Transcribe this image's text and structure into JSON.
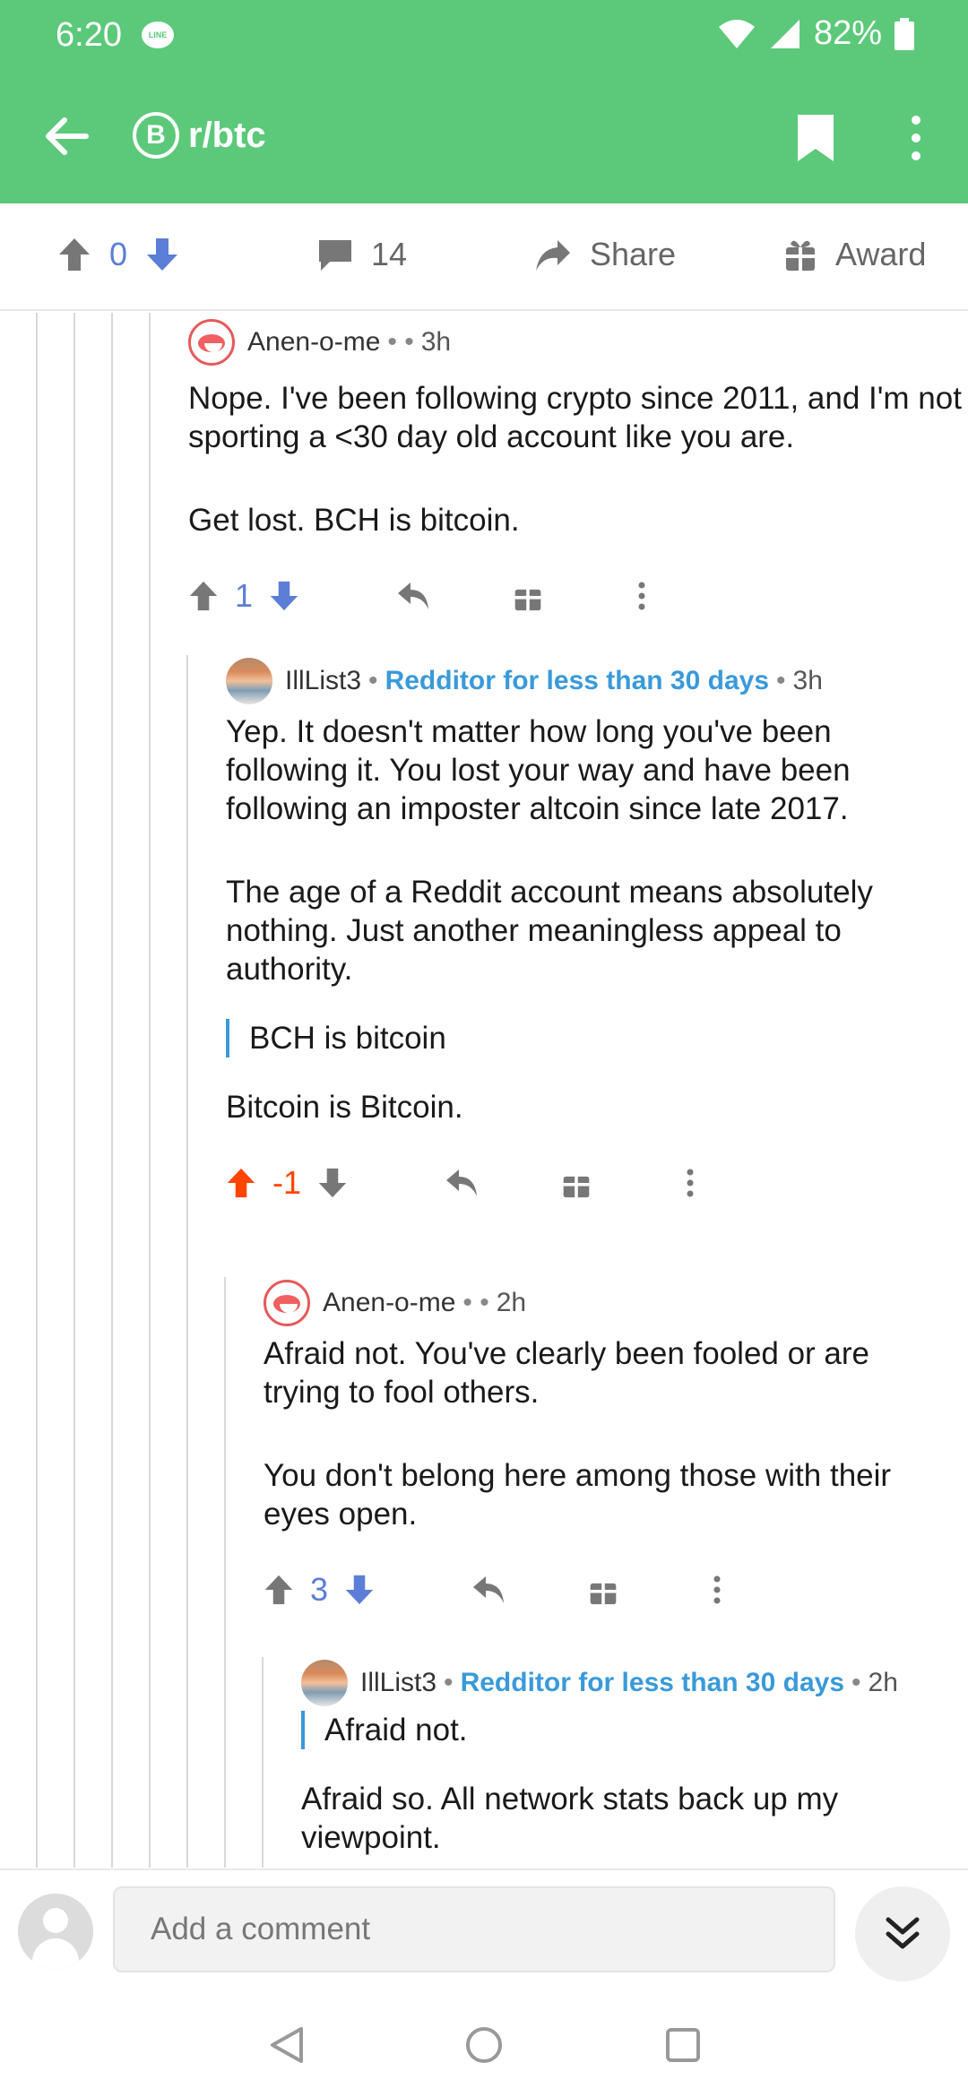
{
  "status_bar": {
    "time": "6:20",
    "line_badge": "LINE",
    "battery": "82%"
  },
  "app_bar": {
    "subreddit_symbol": "B",
    "subreddit": "r/btc"
  },
  "post_bar": {
    "score": "0",
    "comments": "14",
    "share_label": "Share",
    "award_label": "Award"
  },
  "comments": [
    {
      "author": "Anen-o-me",
      "flair": "",
      "age": "3h",
      "paragraphs": [
        "Nope. I've been following crypto since 2011, and I'm not sporting a <30 day old account like you are.",
        "Get lost. BCH is bitcoin."
      ],
      "score": "1"
    },
    {
      "author": "IllList3",
      "flair": "Redditor for less than 30 days",
      "age": "3h",
      "paragraphs": [
        "Yep.  It doesn't matter how long you've been following it.  You lost your way and have been following an imposter altcoin since late 2017.",
        "The age of a Reddit account means absolutely nothing.  Just another meaningless appeal to authority."
      ],
      "quote": "BCH is bitcoin",
      "after_quote": "Bitcoin is Bitcoin.",
      "score": "-1"
    },
    {
      "author": "Anen-o-me",
      "flair": "",
      "age": "2h",
      "paragraphs": [
        "Afraid not. You've clearly been fooled or are trying to fool others.",
        "You don't belong here among those with their eyes open."
      ],
      "score": "3"
    },
    {
      "author": "IllList3",
      "flair": "Redditor for less than 30 days",
      "age": "2h",
      "quote": "Afraid not.",
      "after_quote": "Afraid so.  All network stats back up my viewpoint."
    }
  ],
  "comment_box": {
    "placeholder": "Add a comment"
  },
  "colors": {
    "app_green": "#5cc97a",
    "upvote_blue": "#5c7ed6",
    "downvote_orange": "#ff4500",
    "flair_blue": "#3a9ad9"
  },
  "icons": [
    "back-arrow-icon",
    "bitcoin-icon",
    "bookmark-icon",
    "more-vertical-icon",
    "upvote-icon",
    "downvote-icon",
    "comment-icon",
    "share-icon",
    "gift-icon",
    "reply-icon",
    "chevron-double-down-icon",
    "nav-back-icon",
    "nav-home-icon",
    "nav-recents-icon"
  ]
}
